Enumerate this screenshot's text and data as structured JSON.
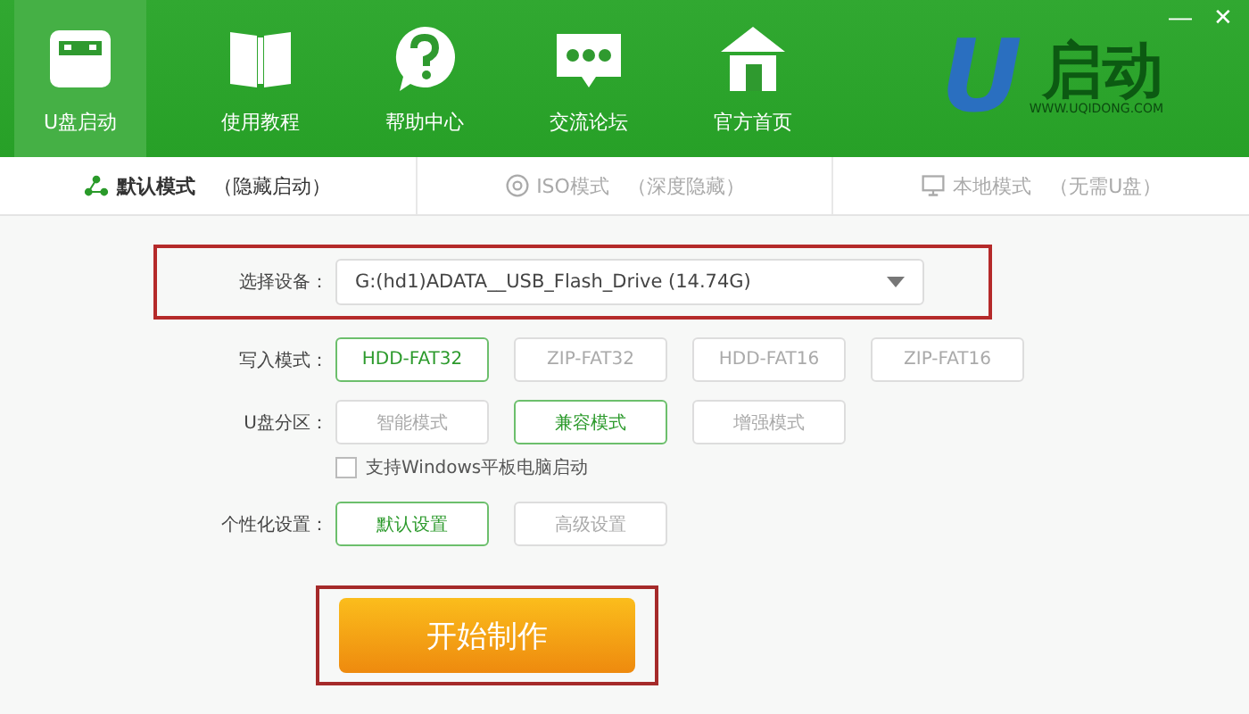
{
  "window": {
    "controls": [
      "—",
      "✕"
    ]
  },
  "nav": [
    {
      "label": "U盘启动",
      "selected": true
    },
    {
      "label": "使用教程",
      "selected": false
    },
    {
      "label": "帮助中心",
      "selected": false
    },
    {
      "label": "交流论坛",
      "selected": false
    },
    {
      "label": "官方首页",
      "selected": false
    }
  ],
  "logo": {
    "mark": "U",
    "name": "启动",
    "url": "WWW.UQIDONG.COM"
  },
  "mode_tabs": [
    {
      "label": "默认模式",
      "note": "（隐藏启动）",
      "selected": true
    },
    {
      "label": "ISO模式",
      "note": "（深度隐藏）",
      "selected": false
    },
    {
      "label": "本地模式",
      "note": "（无需U盘）",
      "selected": false
    }
  ],
  "device": {
    "label": "选择设备：",
    "value": "G:(hd1)ADATA__USB_Flash_Drive (14.74G)",
    "highlighted": true
  },
  "option_rows": [
    {
      "label": "写入模式：",
      "options": [
        {
          "label": "HDD-FAT32",
          "selected": true
        },
        {
          "label": "ZIP-FAT32",
          "selected": false
        },
        {
          "label": "HDD-FAT16",
          "selected": false
        },
        {
          "label": "ZIP-FAT16",
          "selected": false
        }
      ]
    },
    {
      "label": "U盘分区：",
      "options": [
        {
          "label": "智能模式",
          "selected": false
        },
        {
          "label": "兼容模式",
          "selected": true
        },
        {
          "label": "增强模式",
          "selected": false
        }
      ]
    }
  ],
  "tablet_support": {
    "label": "支持Windows平板电脑启动",
    "checked": false
  },
  "personalize": {
    "label": "个性化设置：",
    "options": [
      {
        "label": "默认设置",
        "selected": true
      },
      {
        "label": "高级设置",
        "selected": false
      }
    ]
  },
  "start_button": {
    "label": "开始制作",
    "highlighted": true
  }
}
